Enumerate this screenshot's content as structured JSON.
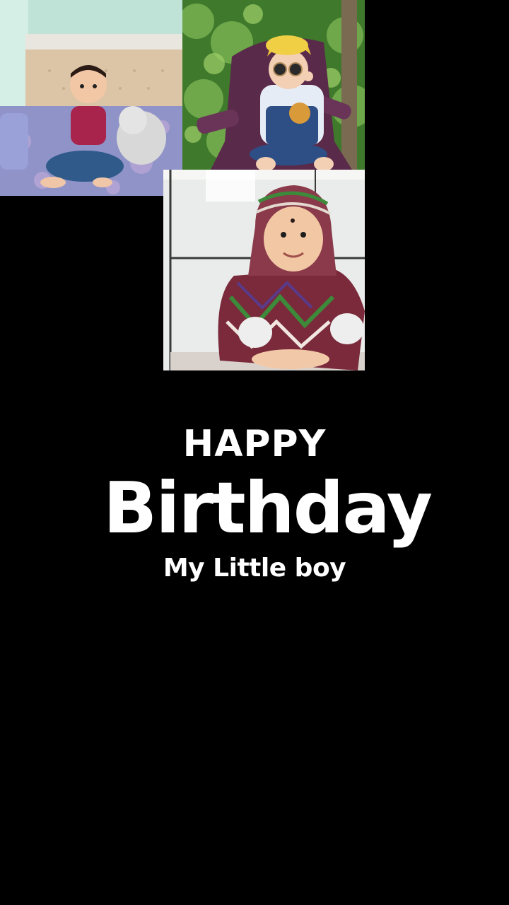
{
  "photos": [
    {
      "name": "baby-sitting-on-bed"
    },
    {
      "name": "baby-in-chair-with-sunglasses"
    },
    {
      "name": "baby-in-colorful-hood"
    }
  ],
  "caption": {
    "line1": "HAPPY",
    "line2": "Birthday",
    "line3": "My Little boy"
  },
  "colors": {
    "background": "#000000",
    "text": "#ffffff"
  }
}
